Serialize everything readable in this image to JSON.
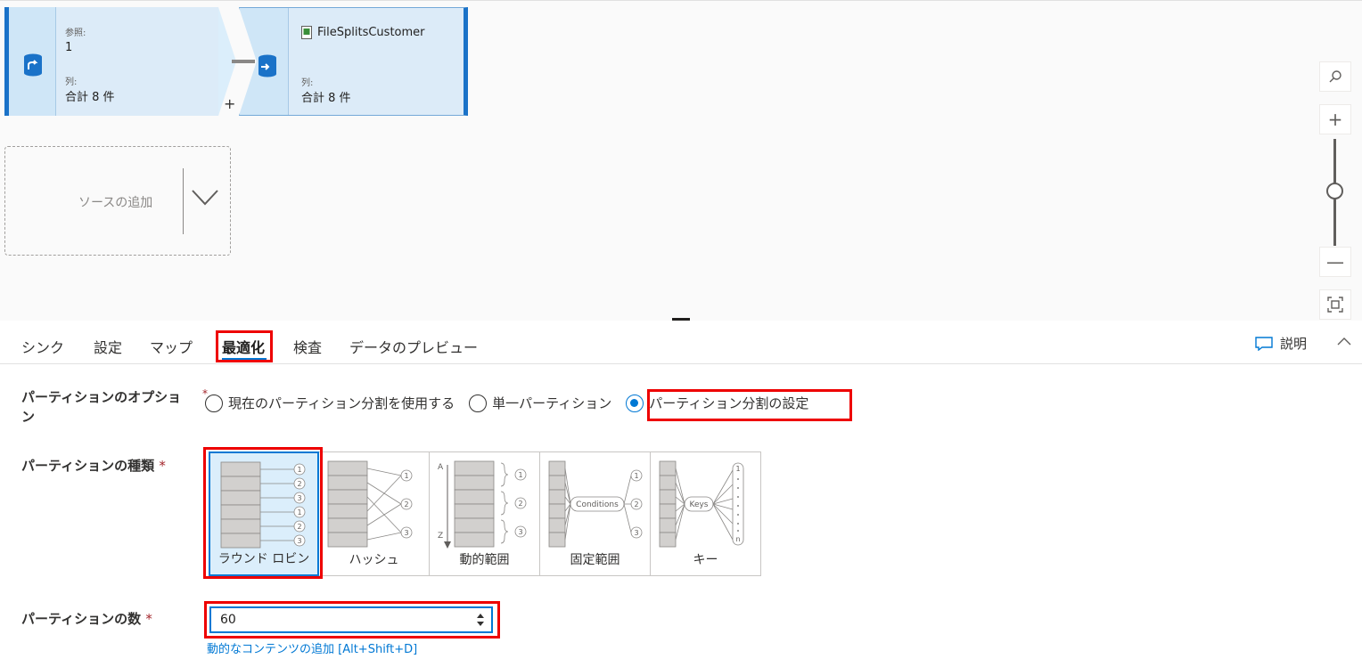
{
  "canvas": {
    "ref_node": {
      "ref_label": "参照:",
      "ref_value": "1",
      "cols_label": "列:",
      "cols_value": "合計 8 件"
    },
    "sink_node": {
      "title": "FileSplitsCustomer",
      "cols_label": "列:",
      "cols_value": "合計 8 件"
    },
    "plus": "+",
    "add_source": "ソースの追加",
    "zoom": {
      "search": "search-icon",
      "in": "+",
      "out": "—"
    }
  },
  "tabs": [
    "シンク",
    "設定",
    "マップ",
    "最適化",
    "検査",
    "データのプレビュー"
  ],
  "active_tab": "最適化",
  "explain_label": "説明",
  "form": {
    "partition_option_label": "パーティションのオプショ\nン",
    "partition_option_required": "*",
    "options": [
      "現在のパーティション分割を使用する",
      "単一パーティション",
      "パーティション分割の設定"
    ],
    "selected_option": "パーティション分割の設定",
    "partition_type_label": "パーティションの種類",
    "partition_types": [
      "ラウンド ロビン",
      "ハッシュ",
      "動的範囲",
      "固定範囲",
      "キー"
    ],
    "selected_type": "ラウンド ロビン",
    "diagram_text": {
      "conditions": "Conditions",
      "keys": "Keys",
      "a": "A",
      "z": "Z",
      "n": "n"
    },
    "partition_count_label": "パーティションの数",
    "partition_count_value": "60",
    "dynamic_content_link": "動的なコンテンツの追加 [Alt+Shift+D]",
    "required_mark": "*"
  },
  "colors": {
    "accent": "#0078d4",
    "highlight": "#e00000",
    "node_bg": "#dbeefb"
  }
}
